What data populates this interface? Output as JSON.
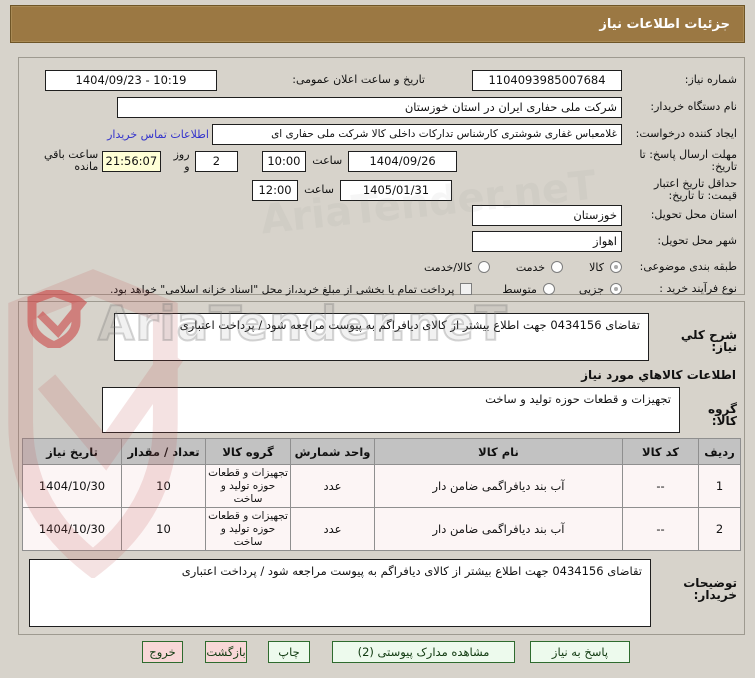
{
  "header": {
    "title": "جزئیات اطلاعات نیاز"
  },
  "form": {
    "need_no_label": "شماره نیاز:",
    "need_no": "1104093985007684",
    "announce_label": "تاریخ و ساعت اعلان عمومی:",
    "announce_value": "1404/09/23 - 10:19",
    "buyer_org_label": "نام دستگاه خریدار:",
    "buyer_org": "شرکت ملی حفاری ایران در استان خوزستان",
    "creator_label": "ایجاد کننده درخواست:",
    "creator": "غلامعباس غفاری شوشتری کارشناس تدارکات داخلی کالا شرکت ملی حفاری ای",
    "contact_link": "اطلاعات تماس خریدار",
    "deadline_label": "مهلت ارسال پاسخ: تا تاریخ:",
    "deadline_date": "1404/09/26",
    "hour_label": "ساعت",
    "deadline_time": "10:00",
    "days_value": "2",
    "days_label": "روز و",
    "remaining_time": "21:56:07",
    "remaining_label": "ساعت باقي مانده",
    "validity_label": "حداقل تاریخ اعتبار قیمت: تا تاریخ:",
    "validity_date": "1405/01/31",
    "validity_time": "12:00",
    "province_label": "استان محل تحویل:",
    "province": "خوزستان",
    "city_label": "شهر محل تحویل:",
    "city": "اهواز",
    "classification_label": "طبقه بندی موضوعی:",
    "classification_options": [
      "کالا",
      "خدمت",
      "کالا/خدمت"
    ],
    "process_label": "نوع فرآیند خرید :",
    "process_options": [
      "جزیی",
      "متوسط"
    ],
    "treasury_note": "پرداخت تمام یا بخشی از مبلغ خرید،از محل \"اسناد خزانه اسلامی\" خواهد بود."
  },
  "description": {
    "label": "شرح کلي نیاز:",
    "value": "تقاضای 0434156 جهت اطلاع بیشتر از کالای دیافراگم به پیوست مراجعه شود / پرداخت اعتباری"
  },
  "goods_section": {
    "title": "اطلاعات کالاهاي مورد نیاز",
    "group_label": "گروه کالا:",
    "group_value": "تجهیزات و قطعات حوزه تولید و ساخت"
  },
  "table": {
    "headers": [
      "ردیف",
      "کد کالا",
      "نام کالا",
      "واحد شمارش",
      "گروه کالا",
      "تعداد / مقدار",
      "تاریخ نیاز"
    ],
    "rows": [
      {
        "no": "1",
        "code": "--",
        "name": "آب بند دیافراگمی ضامن دار",
        "unit": "عدد",
        "group": "تجهیزات و قطعات حوزه تولید و ساخت",
        "qty": "10",
        "date": "1404/10/30"
      },
      {
        "no": "2",
        "code": "--",
        "name": "آب بند دیافراگمی ضامن دار",
        "unit": "عدد",
        "group": "تجهیزات و قطعات حوزه تولید و ساخت",
        "qty": "10",
        "date": "1404/10/30"
      }
    ]
  },
  "notes": {
    "label": "توضیحات خریدار:",
    "value": "تقاضای 0434156 جهت اطلاع بیشتر از کالای دیافراگم به پیوست مراجعه شود / پرداخت اعتباری"
  },
  "buttons": {
    "respond": "پاسخ به نیاز",
    "attachments": "مشاهده مدارک پیوستی (2)",
    "print": "چاپ",
    "back": "بازگشت",
    "exit": "خروج"
  },
  "watermark": {
    "text": "AriaTender.neT"
  },
  "colors": {
    "titlebar": "#9b7843",
    "panel_bg": "#d7d3cb",
    "highlight_yellow": "#ffffd6",
    "table_header": "#c2c2c2",
    "button_green": "#edfaed",
    "button_pink": "#f8d7d7",
    "link_blue": "#3333cc"
  }
}
